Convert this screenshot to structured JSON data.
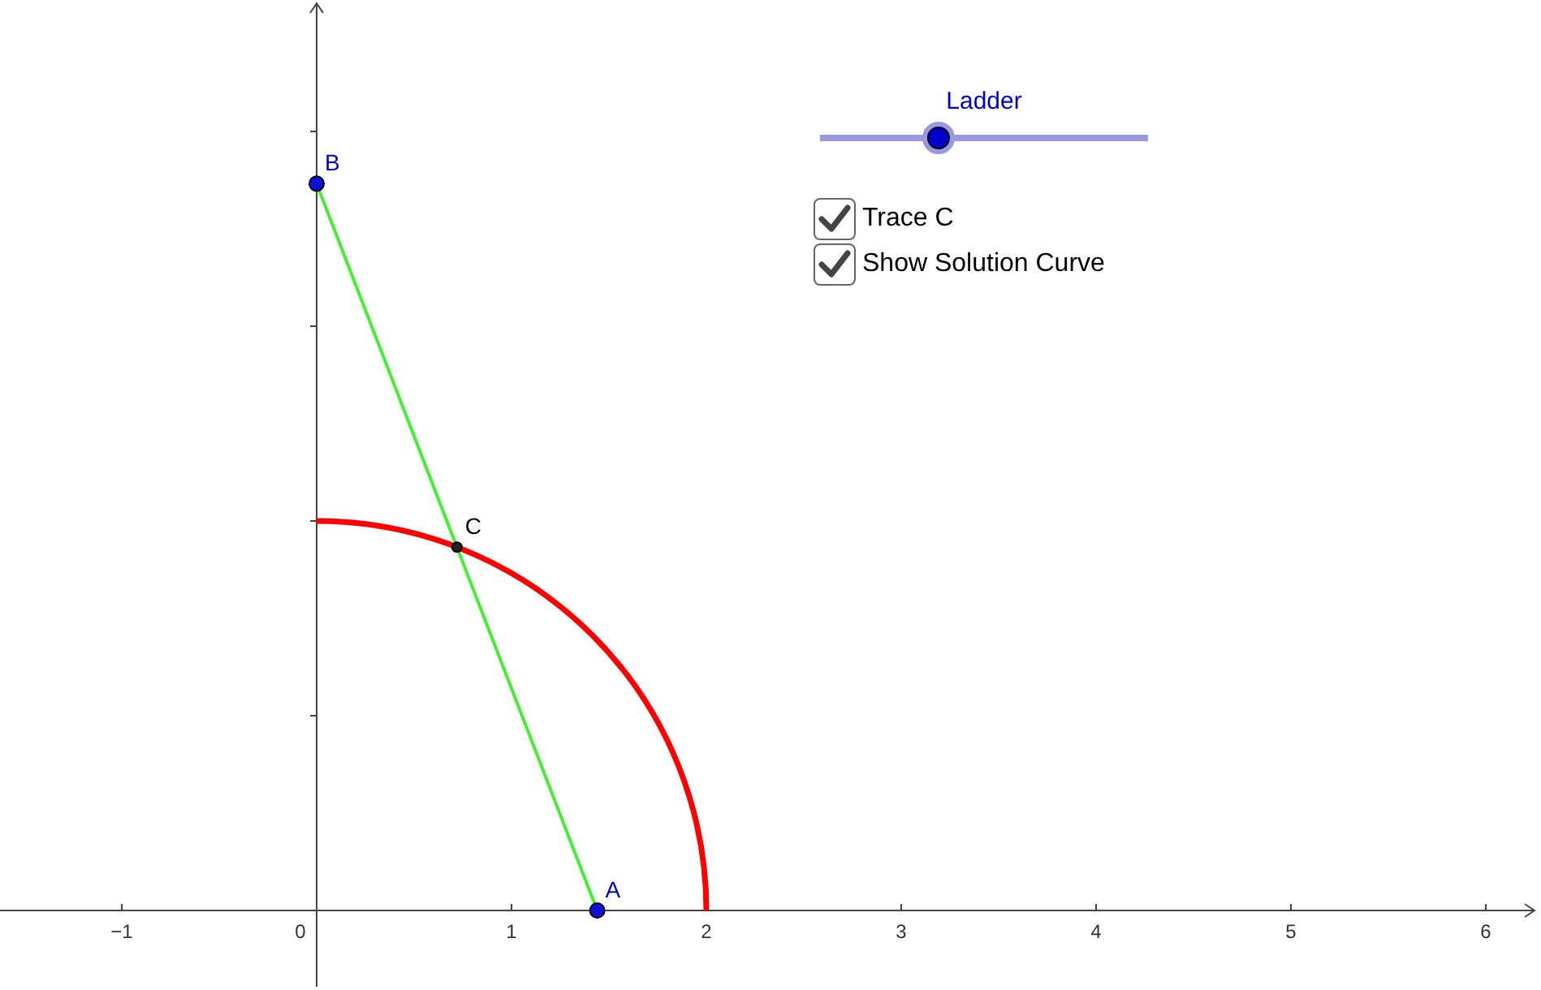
{
  "slider": {
    "label": "Ladder",
    "level": 0.36
  },
  "checkboxes": [
    {
      "label": "Trace C",
      "checked": true
    },
    {
      "label": "Show Solution Curve",
      "checked": true
    }
  ],
  "points": [
    {
      "label": "B",
      "kind": "top"
    },
    {
      "label": "C",
      "kind": "middle"
    },
    {
      "label": "A",
      "kind": "foot"
    }
  ],
  "x_axis": {
    "tick_labels": [
      "−1",
      "0",
      "1",
      "2",
      "3",
      "4",
      "5",
      "6"
    ]
  }
}
